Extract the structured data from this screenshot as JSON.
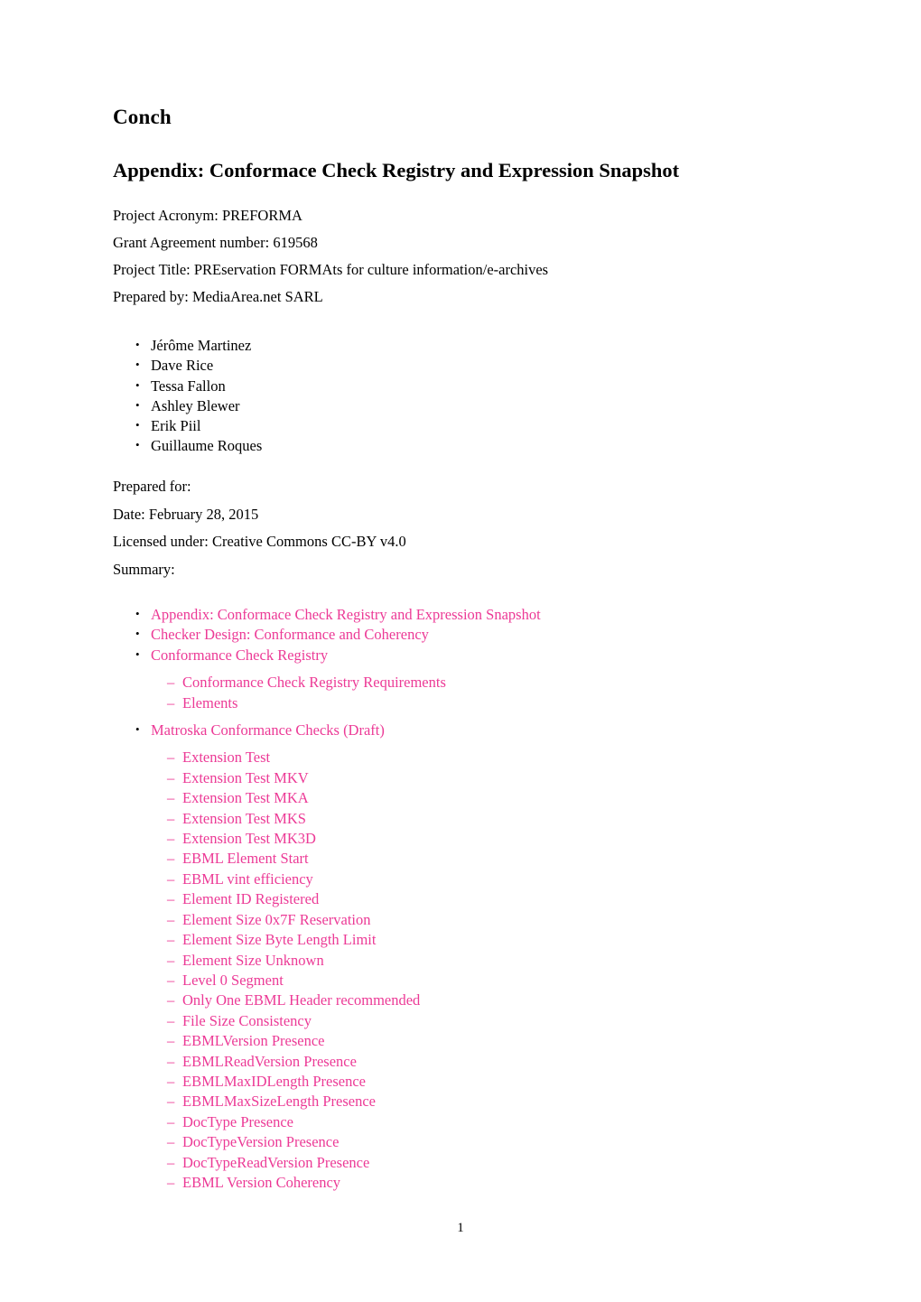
{
  "document": {
    "title": "Conch",
    "subtitle": "Appendix:  Conformace Check Registry and Expression Snapshot",
    "page_number": "1",
    "link_color": "#EC3A96",
    "text_color": "#000000",
    "background_color": "#FFFFFF"
  },
  "metadata": {
    "project_acronym": "Project Acronym: PREFORMA",
    "grant_agreement": "Grant Agreement number: 619568",
    "project_title": "Project Title: PREservation FORMAts for culture information/e-archives",
    "prepared_by": "Prepared by: MediaArea.net SARL"
  },
  "authors": [
    "Jérôme Martinez",
    "Dave Rice",
    "Tessa Fallon",
    "Ashley Blewer",
    "Erik Piil",
    "Guillaume Roques"
  ],
  "prepared_for": {
    "prepared_for": "Prepared for:",
    "date": "Date: February 28, 2015",
    "license": "Licensed under: Creative Commons CC-BY v4.0",
    "summary": "Summary:"
  },
  "toc": {
    "top_level": [
      "Appendix: Conformace Check Registry and Expression Snapshot",
      "Checker Design: Conformance and Coherency",
      "Conformance Check Registry"
    ],
    "registry_sub": [
      "Conformance Check Registry Requirements",
      "Elements"
    ],
    "matroska_heading": "Matroska Conformance Checks (Draft)",
    "matroska_sub": [
      "Extension Test",
      "Extension Test MKV",
      "Extension Test MKA",
      "Extension Test MKS",
      "Extension Test MK3D",
      "EBML Element Start",
      "EBML vint efficiency",
      "Element ID Registered",
      "Element Size 0x7F Reservation",
      "Element Size Byte Length Limit",
      "Element Size Unknown",
      "Level 0 Segment",
      "Only One EBML Header recommended",
      "File Size Consistency",
      "EBMLVersion Presence",
      "EBMLReadVersion Presence",
      "EBMLMaxIDLength Presence",
      "EBMLMaxSizeLength Presence",
      "DocType Presence",
      "DocTypeVersion Presence",
      "DocTypeReadVersion Presence",
      "EBML Version Coherency"
    ]
  }
}
